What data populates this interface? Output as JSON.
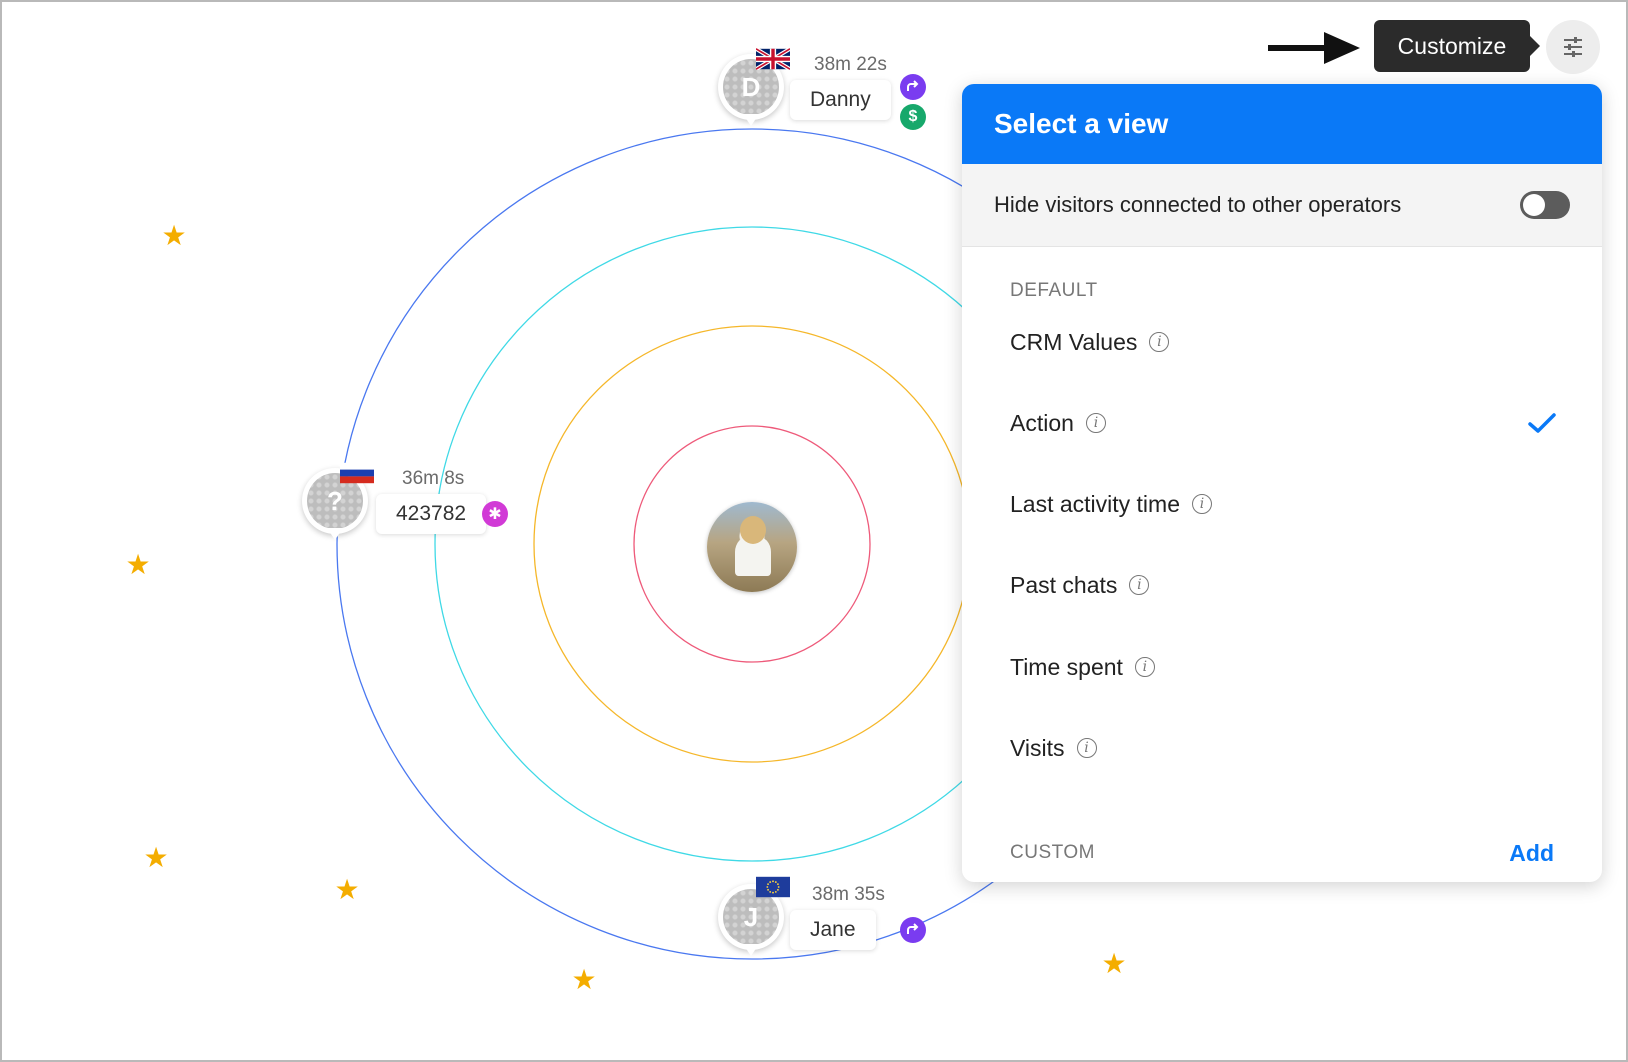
{
  "tooltip": {
    "label": "Customize"
  },
  "icons": {
    "settings": "sliders-icon",
    "pointer": "arrow-right-icon",
    "check": "checkmark-icon",
    "info": "info-icon",
    "star": "star-icon"
  },
  "colors": {
    "accent": "#0a79f7",
    "ring_outer": "#4a78f0",
    "ring_second": "#3fd9e6",
    "ring_third": "#f5b72a",
    "ring_inner": "#ee5a7a",
    "star": "#f4ad00"
  },
  "visitors": [
    {
      "name": "Danny",
      "time": "38m 22s",
      "initial": "D",
      "flag": "uk-flag-icon",
      "badges": [
        "redirect-icon",
        "dollar-icon"
      ]
    },
    {
      "name": "423782",
      "time": "36m 8s",
      "initial": "?",
      "flag": "russia-flag-icon",
      "badges": [
        "asterisk-icon"
      ]
    },
    {
      "name": "Jane",
      "time": "38m 35s",
      "initial": "J",
      "flag": "eu-flag-icon",
      "badges": [
        "redirect-icon"
      ]
    }
  ],
  "panel": {
    "title": "Select a view",
    "hide_label": "Hide visitors connected to other operators",
    "hide_enabled": false,
    "default_label": "DEFAULT",
    "views": [
      {
        "label": "CRM Values",
        "selected": false
      },
      {
        "label": "Action",
        "selected": true
      },
      {
        "label": "Last activity time",
        "selected": false
      },
      {
        "label": "Past chats",
        "selected": false
      },
      {
        "label": "Time spent",
        "selected": false
      },
      {
        "label": "Visits",
        "selected": false
      }
    ],
    "custom_label": "CUSTOM",
    "add_label": "Add"
  },
  "badge_symbols": {
    "asterisk": "✱",
    "dollar": "$"
  }
}
